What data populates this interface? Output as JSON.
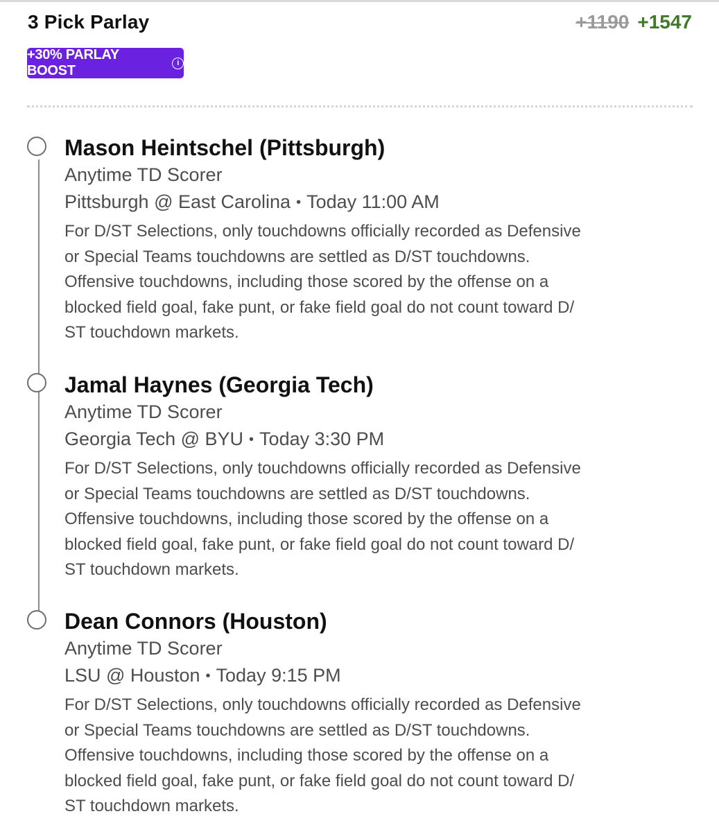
{
  "header": {
    "title": "3 Pick Parlay",
    "original_odds": "+1190",
    "boosted_odds": "+1547"
  },
  "boost_badge": {
    "label": "+30% PARLAY BOOST",
    "info_icon": "info-icon",
    "color": "#6b22e0"
  },
  "colors": {
    "boosted_odds": "#3f7a2b",
    "original_odds": "#9a9a9a"
  },
  "legs": [
    {
      "name": "Mason Heintschel (Pittsburgh)",
      "market": "Anytime TD Scorer",
      "matchup": "Pittsburgh @ East Carolina",
      "separator": "•",
      "time": "Today 11:00 AM",
      "rules": [
        "For D/ST Selections, only touchdowns officially recorded as Defensive",
        "or Special Teams touchdowns are settled as D/ST touchdowns.",
        "Offensive touchdowns, including those scored by the offense on a",
        "blocked field goal, fake punt, or fake field goal do not count toward D/",
        "ST touchdown markets."
      ]
    },
    {
      "name": "Jamal Haynes (Georgia Tech)",
      "market": "Anytime TD Scorer",
      "matchup": "Georgia Tech @ BYU",
      "separator": "•",
      "time": "Today 3:30 PM",
      "rules": [
        "For D/ST Selections, only touchdowns officially recorded as Defensive",
        "or Special Teams touchdowns are settled as D/ST touchdowns.",
        "Offensive touchdowns, including those scored by the offense on a",
        "blocked field goal, fake punt, or fake field goal do not count toward D/",
        "ST touchdown markets."
      ]
    },
    {
      "name": "Dean Connors (Houston)",
      "market": "Anytime TD Scorer",
      "matchup": "LSU @ Houston",
      "separator": "•",
      "time": "Today 9:15 PM",
      "rules": [
        "For D/ST Selections, only touchdowns officially recorded as Defensive",
        "or Special Teams touchdowns are settled as D/ST touchdowns.",
        "Offensive touchdowns, including those scored by the offense on a",
        "blocked field goal, fake punt, or fake field goal do not count toward D/",
        "ST touchdown markets."
      ]
    }
  ]
}
